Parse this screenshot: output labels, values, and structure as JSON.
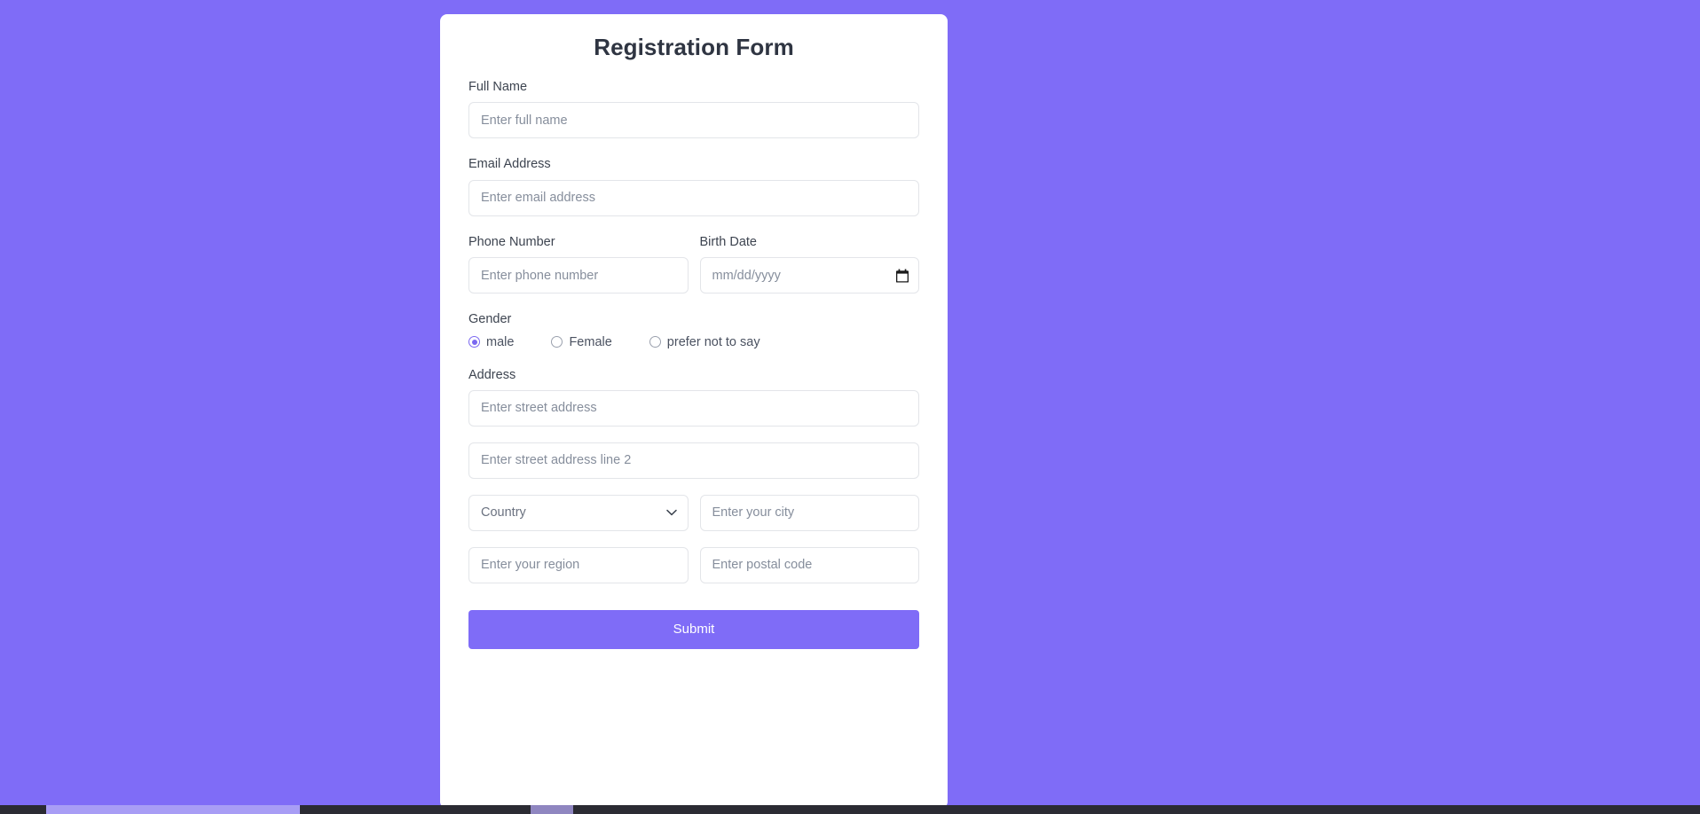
{
  "theme": {
    "background": "#7f6cf7",
    "accent": "#7f6cf7",
    "card_background": "#ffffff",
    "title_color": "#2f3542",
    "label_color": "#3d4450",
    "placeholder_color": "#868e9c",
    "border_color": "#e3e5e9",
    "radio_checked_color": "#7b68f0",
    "submit_text_color": "#ffffff"
  },
  "form": {
    "title": "Registration Form",
    "full_name": {
      "label": "Full Name",
      "placeholder": "Enter full name",
      "value": ""
    },
    "email": {
      "label": "Email Address",
      "placeholder": "Enter email address",
      "value": ""
    },
    "phone": {
      "label": "Phone Number",
      "placeholder": "Enter phone number",
      "value": ""
    },
    "birth_date": {
      "label": "Birth Date",
      "placeholder": "mm/dd/yyyy",
      "value": "",
      "icon": "calendar-icon"
    },
    "gender": {
      "label": "Gender",
      "selected": "male",
      "options": [
        {
          "label": "male",
          "checked": true
        },
        {
          "label": "Female",
          "checked": false
        },
        {
          "label": "prefer not to say",
          "checked": false
        }
      ]
    },
    "address": {
      "label": "Address",
      "street1": {
        "placeholder": "Enter street address",
        "value": ""
      },
      "street2": {
        "placeholder": "Enter street address line 2",
        "value": ""
      },
      "country": {
        "selected": "Country",
        "options": [
          "Country"
        ],
        "icon": "chevron-down-icon"
      },
      "city": {
        "placeholder": "Enter your city",
        "value": ""
      },
      "region": {
        "placeholder": "Enter your region",
        "value": ""
      },
      "postal_code": {
        "placeholder": "Enter postal code",
        "value": ""
      }
    },
    "submit": {
      "label": "Submit"
    }
  }
}
